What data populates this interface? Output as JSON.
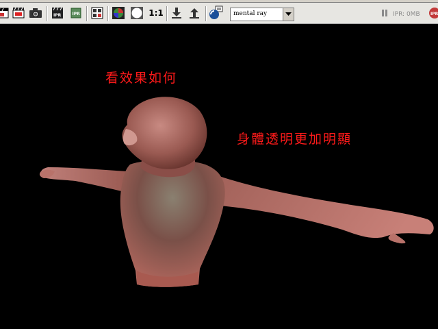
{
  "toolbar": {
    "icons": [
      "render-region-icon",
      "render-clip-icon",
      "snapshot-camera-icon",
      "ipr-clip-icon",
      "ipr-refresh-icon",
      "render-sequence-icon",
      "color-channels-icon",
      "alpha-channel-icon",
      "keep-image-icon",
      "load-image-icon",
      "save-image-icon",
      "render-settings-icon"
    ],
    "ratio_label": "1:1",
    "renderer_select_value": "mental ray",
    "ipr_status": "IPR: 0MB"
  },
  "viewport": {
    "background": "#000000",
    "captions": {
      "top": "看效果如何",
      "right": "身體透明更加明顯"
    },
    "caption_color": "#ff1a1a"
  }
}
